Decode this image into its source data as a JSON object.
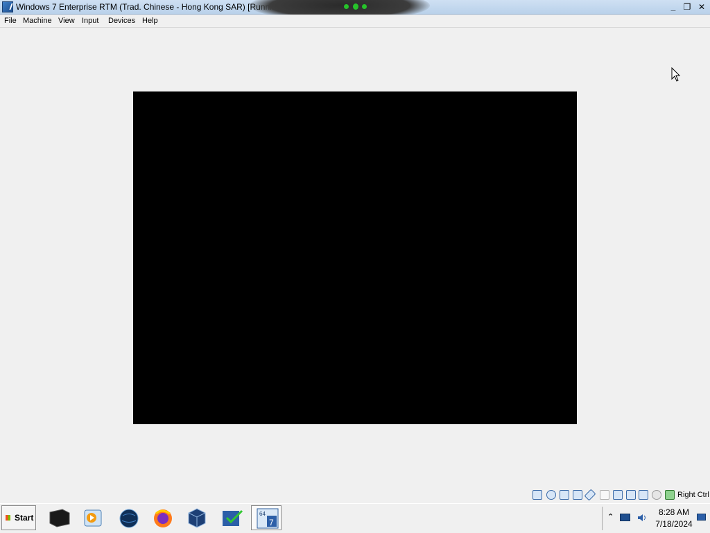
{
  "window": {
    "title": "Windows 7 Enterprise RTM (Trad. Chinese - Hong Kong SAR) [Running] - Oracle VM VirtualBox",
    "minimize_glyph": "_",
    "restore_glyph": "❐",
    "close_glyph": "✕"
  },
  "menu": {
    "items": [
      "File",
      "Machine",
      "View",
      "Input",
      "Devices",
      "Help"
    ]
  },
  "statusbar": {
    "icons": [
      "hard-disk-icon",
      "optical-drive-icon",
      "audio-icon",
      "network-icon",
      "usb-icon",
      "shared-folders-icon",
      "display-icon",
      "video-capture-icon",
      "cpu-icon",
      "mouse-integration-icon",
      "keyboard-icon"
    ],
    "host_key": "Right Ctrl"
  },
  "taskbar": {
    "start_label": "Start",
    "apps": [
      "terminal-icon",
      "media-player-icon",
      "globe-icon",
      "firefox-icon",
      "virtualbox-icon",
      "vm-checklist-icon",
      "windows7-vm-icon"
    ],
    "time": "8:28 AM",
    "date": "7/18/2024"
  },
  "colors": {
    "titlebar": "#c4d9ef",
    "guest_screen": "#000000",
    "background": "#f0f0f0"
  }
}
